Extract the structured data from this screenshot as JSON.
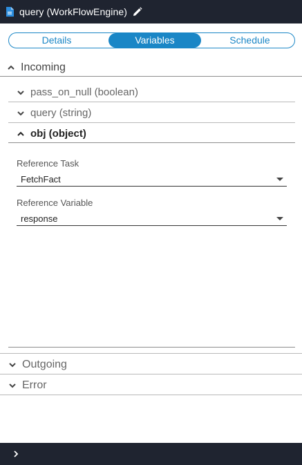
{
  "titlebar": {
    "title": "query (WorkFlowEngine)"
  },
  "tabs": [
    {
      "label": "Details"
    },
    {
      "label": "Variables"
    },
    {
      "label": "Schedule"
    }
  ],
  "incoming": {
    "label": "Incoming",
    "items": [
      {
        "label": "pass_on_null (boolean)"
      },
      {
        "label": "query (string)"
      },
      {
        "label": "obj (object)"
      }
    ],
    "reference_task": {
      "label": "Reference Task",
      "value": "FetchFact"
    },
    "reference_variable": {
      "label": "Reference Variable",
      "value": "response"
    }
  },
  "outgoing": {
    "label": "Outgoing"
  },
  "error": {
    "label": "Error"
  },
  "colors": {
    "accent": "#1a86c6",
    "bar": "#1f2430"
  }
}
